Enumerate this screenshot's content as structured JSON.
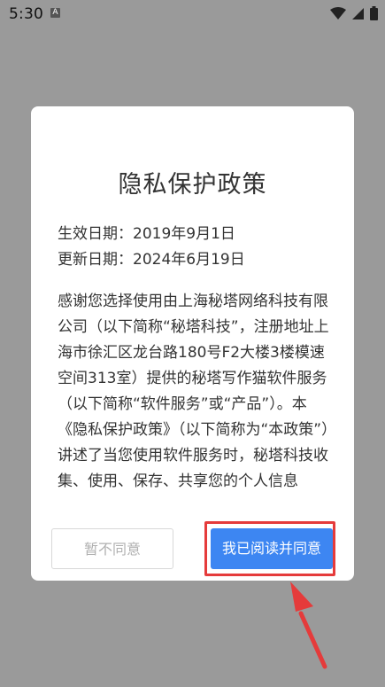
{
  "status_bar": {
    "time": "5:30",
    "notification_icon_letter": "A"
  },
  "dialog": {
    "title": "隐私保护政策",
    "effective_date": "生效日期：2019年9月1日",
    "updated_date": "更新日期：2024年6月19日",
    "body": "感谢您选择使用由上海秘塔网络科技有限公司（以下简称“秘塔科技”，注册地址上海市徐汇区龙台路180号F2大楼3楼模速空间313室）提供的秘塔写作猫软件服务（以下简称“软件服务”或“产品”）。本《隐私保护政策》（以下简称为“本政策”）讲述了当您使用软件服务时，秘塔科技收集、使用、保存、共享您的个人信息",
    "decline_label": "暂不同意",
    "accept_label": "我已阅读并同意"
  },
  "colors": {
    "overlay": "#9a9a9a",
    "accept_button": "#3d86f2",
    "highlight": "#e53b3b"
  }
}
